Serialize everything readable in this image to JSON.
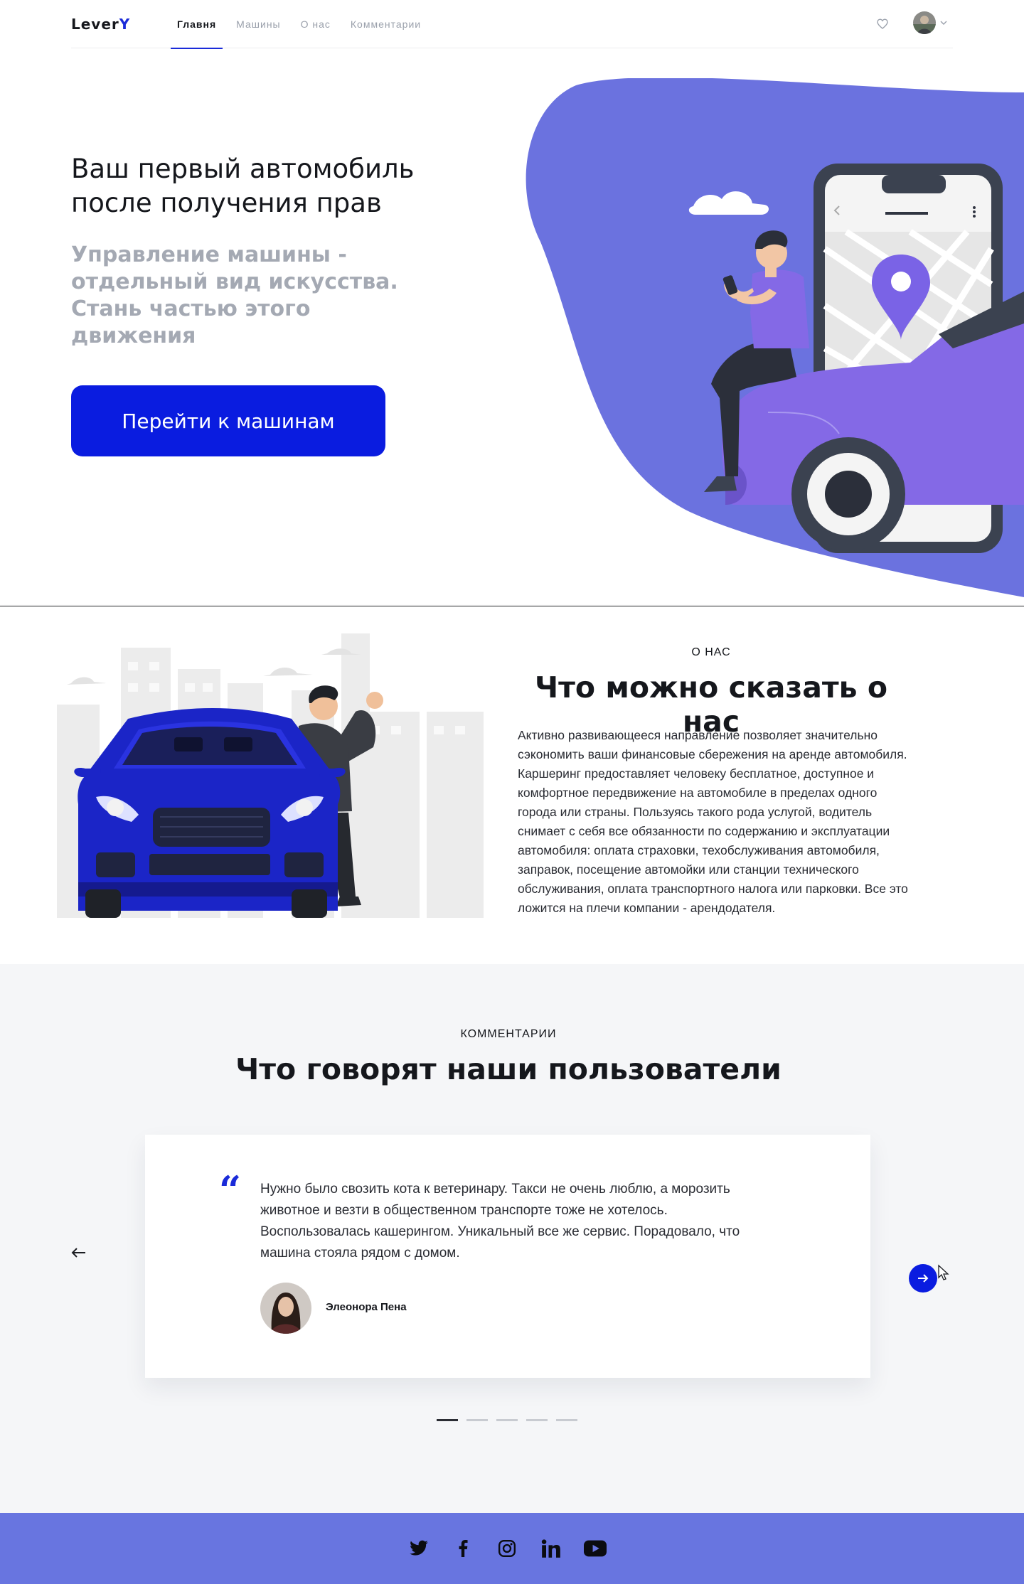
{
  "header": {
    "logo_main": "Lever",
    "logo_accent": "Y",
    "nav": [
      {
        "label": "Главня",
        "active": true
      },
      {
        "label": "Машины",
        "active": false
      },
      {
        "label": "О нас",
        "active": false
      },
      {
        "label": "Комментарии",
        "active": false
      }
    ],
    "icons": {
      "favorites": "heart-icon",
      "dropdown": "chevron-down-icon"
    }
  },
  "hero": {
    "title": "Ваш первый автомобиль после получения прав",
    "subtitle": "Управление машины - отдельный вид искусства. Стань частью этого движения",
    "cta_label": "Перейти к машинам"
  },
  "about": {
    "kicker": "О НАС",
    "title": "Что можно сказать о нас",
    "paragraph_1": "Активно развивающееся направление позволяет значительно сэкономить ваши финансовые сбережения на аренде автомобиля.",
    "paragraph_2": "Каршеринг предоставляет человеку бесплатное, доступное и комфортное передвижение на автомобиле в пределах одного города или страны. Пользуясь такого рода услугой, водитель снимает с себя все обязанности по содержанию и эксплуатации автомобиля: оплата страховки, техобслуживания автомобиля, заправок, посещение автомойки или станции технического обслуживания, оплата транспортного налога или парковки. Все это ложится на плечи компании - арендодателя."
  },
  "reviews": {
    "kicker": "КОММЕНТАРИИ",
    "title": "Что говорят наши пользователи",
    "quote_mark": "“",
    "quote": "Нужно было свозить кота к ветеринару. Такси не очень люблю, а морозить животное и везти в общественном транспорте тоже не хотелось. Воспользовалась кашерингом. Уникальный все же сервис. Порадовало, что машина стояла рядом с домом.",
    "author": "Элеонора Пена",
    "slides_total": 5,
    "active_slide": 1
  },
  "footer": {
    "socials": [
      "twitter-icon",
      "facebook-icon",
      "instagram-icon",
      "linkedin-icon",
      "youtube-icon"
    ]
  },
  "colors": {
    "accent": "#0a1ce0",
    "brand_purple": "#6875e0",
    "muted_text": "#a4a9b3"
  }
}
